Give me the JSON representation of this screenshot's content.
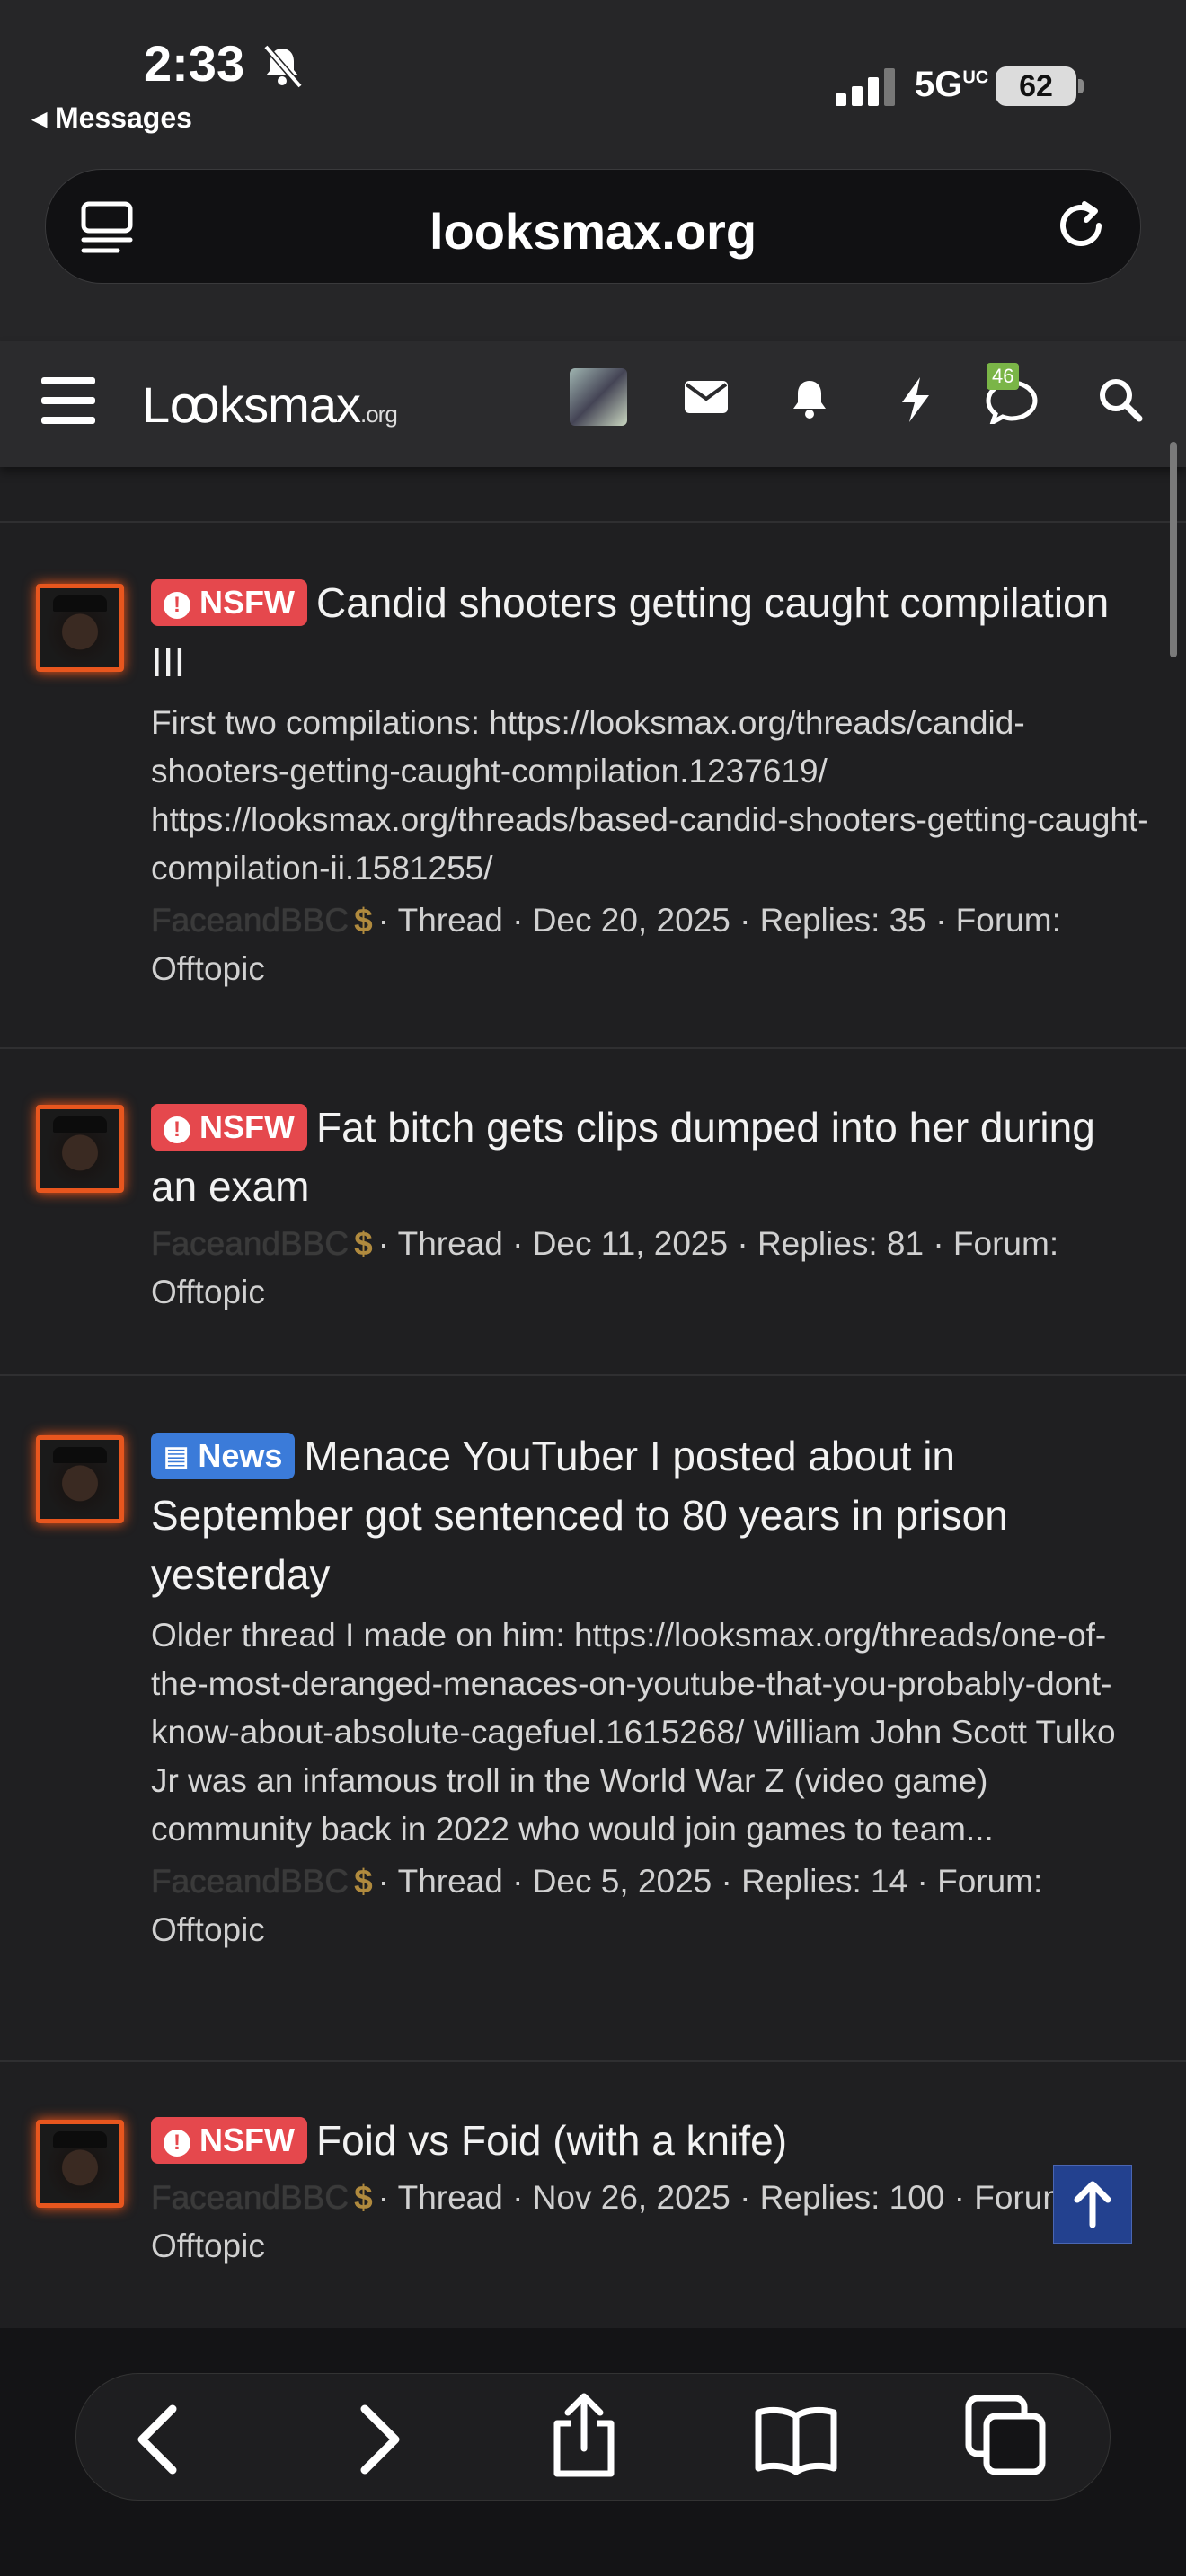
{
  "status": {
    "time": "2:33",
    "back_label": "Messages",
    "network": "5G",
    "network_sup": "UC",
    "battery": "62"
  },
  "browser": {
    "url": "looksmax.org"
  },
  "site": {
    "logo_main": "Lꝏksmax",
    "logo_suffix": ".org",
    "chat_badge": "46"
  },
  "threads": [
    {
      "prefix": "NSFW",
      "prefix_type": "nsfw",
      "title": "Candid shooters getting caught compilation III",
      "snippet": "First two compilations: https://looksmax.org/threads/candid-shooters-getting-caught-compilation.1237619/ https://looksmax.org/threads/based-candid-shooters-getting-caught-compilation-ii.1581255/",
      "author": "FaceandBBC",
      "meta": "· Thread · Dec 20, 2025 · Replies: 35 · Forum: Offtopic"
    },
    {
      "prefix": "NSFW",
      "prefix_type": "nsfw",
      "title": "Fat bitch gets clips dumped into her during an exam",
      "snippet": "",
      "author": "FaceandBBC",
      "meta": "· Thread · Dec 11, 2025 · Replies: 81 · Forum: Offtopic"
    },
    {
      "prefix": "News",
      "prefix_type": "news",
      "title": "Menace YouTuber I posted about in September got sentenced to 80 years in prison yesterday",
      "snippet": "Older thread I made on him: https://looksmax.org/threads/one-of-the-most-deranged-menaces-on-youtube-that-you-probably-dont-know-about-absolute-cagefuel.1615268/ William John Scott Tulko Jr was an infamous troll in the World War Z (video game) community back in 2022 who would join games to team...",
      "author": "FaceandBBC",
      "meta": "· Thread · Dec 5, 2025 · Replies: 14 · Forum: Offtopic"
    },
    {
      "prefix": "NSFW",
      "prefix_type": "nsfw",
      "title": "Foid vs Foid (with a knife)",
      "snippet": "",
      "author": "FaceandBBC",
      "meta": "· Thread · Nov 26, 2025 · Replies: 100 · Forum: Offtopic"
    }
  ]
}
